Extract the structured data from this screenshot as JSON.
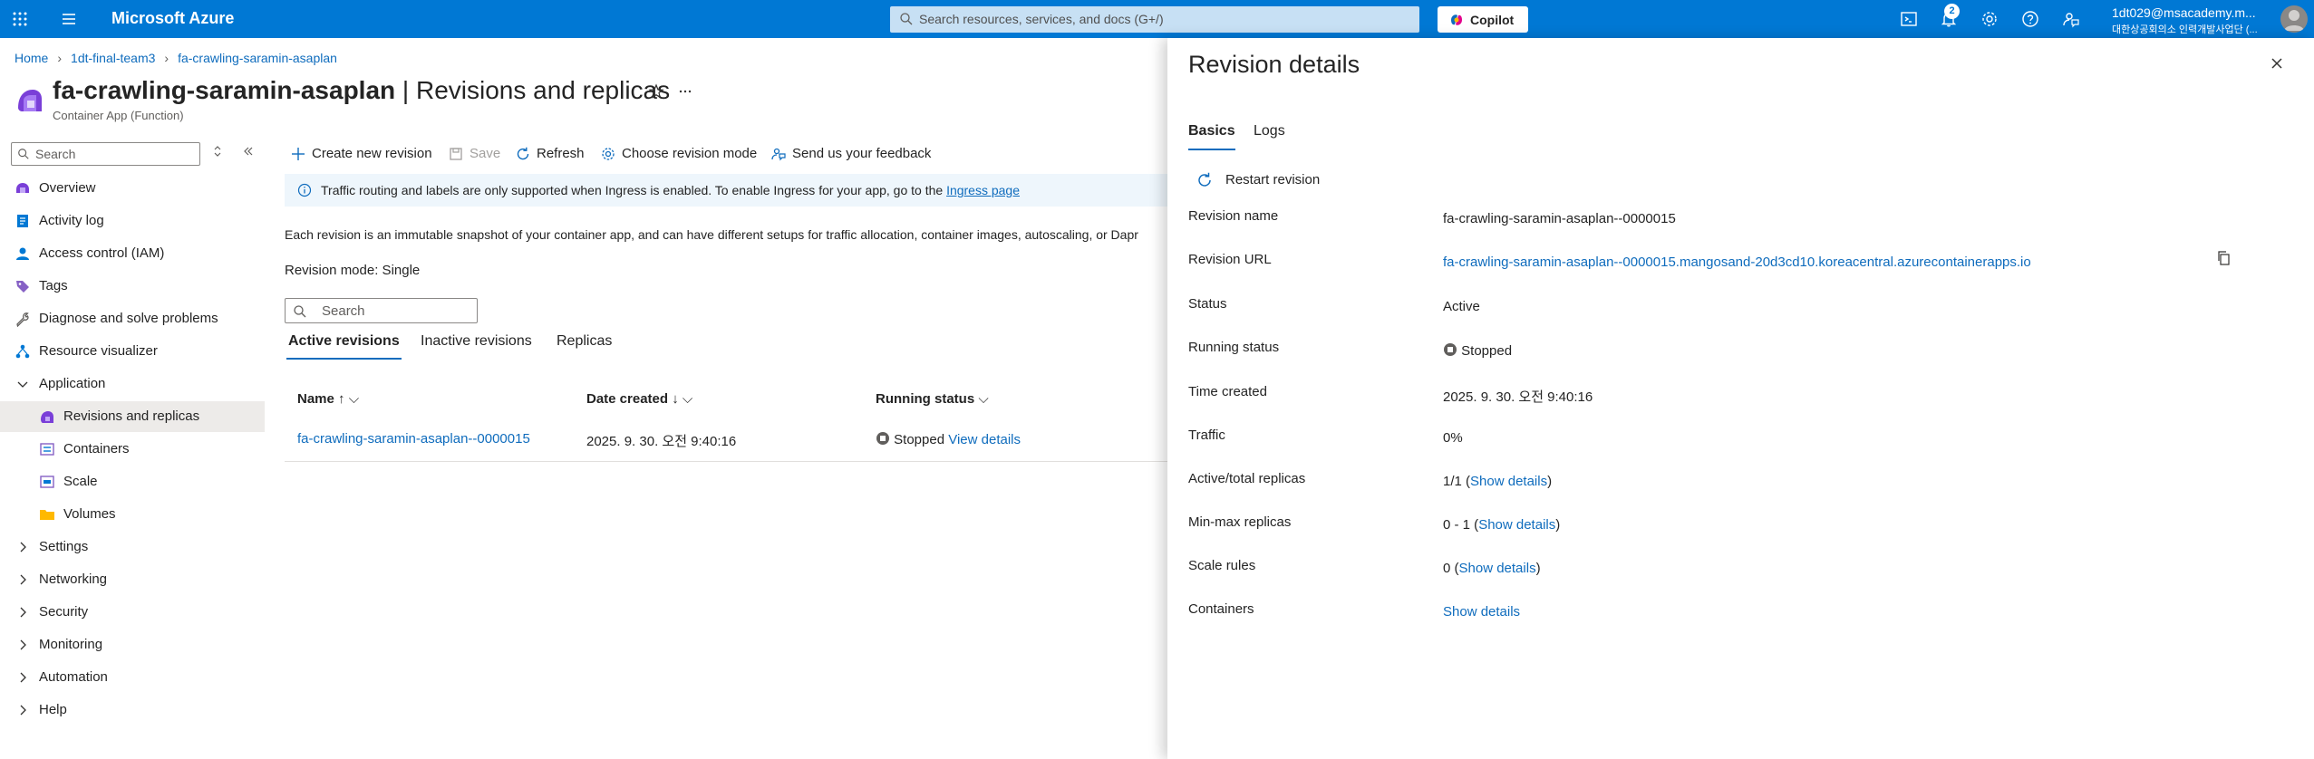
{
  "topbar": {
    "brand": "Microsoft Azure",
    "search_placeholder": "Search resources, services, and docs (G+/)",
    "copilot_label": "Copilot",
    "notification_count": "2",
    "account_name": "1dt029@msacademy.m...",
    "account_org": "대한상공회의소 인력개발사업단 (..."
  },
  "breadcrumb": {
    "items": [
      "Home",
      "1dt-final-team3",
      "fa-crawling-saramin-asaplan"
    ]
  },
  "header": {
    "resource_name": "fa-crawling-saramin-asaplan",
    "separator": " | ",
    "page_name": "Revisions and replicas",
    "subtitle": "Container App (Function)"
  },
  "sidebar": {
    "search_placeholder": "Search",
    "items": [
      {
        "label": "Overview",
        "icon": "overview-icon"
      },
      {
        "label": "Activity log",
        "icon": "activity-log-icon"
      },
      {
        "label": "Access control (IAM)",
        "icon": "iam-icon"
      },
      {
        "label": "Tags",
        "icon": "tag-icon"
      },
      {
        "label": "Diagnose and solve problems",
        "icon": "wrench-icon"
      },
      {
        "label": "Resource visualizer",
        "icon": "visualizer-icon"
      },
      {
        "label": "Application",
        "icon": "chevron-down-icon"
      },
      {
        "label": "Revisions and replicas",
        "icon": "revisions-icon"
      },
      {
        "label": "Containers",
        "icon": "containers-icon"
      },
      {
        "label": "Scale",
        "icon": "scale-icon"
      },
      {
        "label": "Volumes",
        "icon": "folder-icon"
      },
      {
        "label": "Settings",
        "icon": "chevron-right-icon"
      },
      {
        "label": "Networking",
        "icon": "chevron-right-icon"
      },
      {
        "label": "Security",
        "icon": "chevron-right-icon"
      },
      {
        "label": "Monitoring",
        "icon": "chevron-right-icon"
      },
      {
        "label": "Automation",
        "icon": "chevron-right-icon"
      },
      {
        "label": "Help",
        "icon": "chevron-right-icon"
      }
    ]
  },
  "toolbar": {
    "create_label": "Create new revision",
    "save_label": "Save",
    "refresh_label": "Refresh",
    "mode_label": "Choose revision mode",
    "feedback_label": "Send us your feedback"
  },
  "info": {
    "text": "Traffic routing and labels are only supported when Ingress is enabled. To enable Ingress for your app, go to the ",
    "link": "Ingress page"
  },
  "main": {
    "description": "Each revision is an immutable snapshot of your container app, and can have different setups for traffic allocation, container images, autoscaling, or Dapr",
    "revision_mode_label": "Revision mode:",
    "revision_mode_value": " Single",
    "search_placeholder": "Search",
    "tabs": [
      "Active revisions",
      "Inactive revisions",
      "Replicas"
    ],
    "columns": [
      "Name",
      "Date created",
      "Running status"
    ],
    "rows": [
      {
        "name": "fa-crawling-saramin-asaplan--0000015",
        "date": "2025. 9. 30. 오전 9:40:16",
        "status": "Stopped",
        "action": "View details"
      }
    ]
  },
  "panel": {
    "title": "Revision details",
    "tabs": [
      "Basics",
      "Logs"
    ],
    "restart_label": "Restart revision",
    "props": [
      {
        "label": "Revision name",
        "value": "fa-crawling-saramin-asaplan--0000015"
      },
      {
        "label": "Revision URL",
        "value": "fa-crawling-saramin-asaplan--0000015.mangosand-20d3cd10.koreacentral.azurecontainerapps.io"
      },
      {
        "label": "Status",
        "value": "Active"
      },
      {
        "label": "Running status",
        "value": "Stopped"
      },
      {
        "label": "Time created",
        "value": "2025. 9. 30. 오전 9:40:16"
      },
      {
        "label": "Traffic",
        "value": "0%"
      },
      {
        "label": "Active/total replicas",
        "value": "1/1",
        "link": "Show details"
      },
      {
        "label": "Min-max replicas",
        "value": "0 - 1",
        "link": "Show details"
      },
      {
        "label": "Scale rules",
        "value": "0",
        "link": "Show details"
      },
      {
        "label": "Containers",
        "link": "Show details"
      }
    ]
  },
  "colors": {
    "brand_blue": "#0078d4",
    "link": "#0f6cbd",
    "info_bg": "#eef6fc",
    "selected_nav": "#edebe9"
  }
}
